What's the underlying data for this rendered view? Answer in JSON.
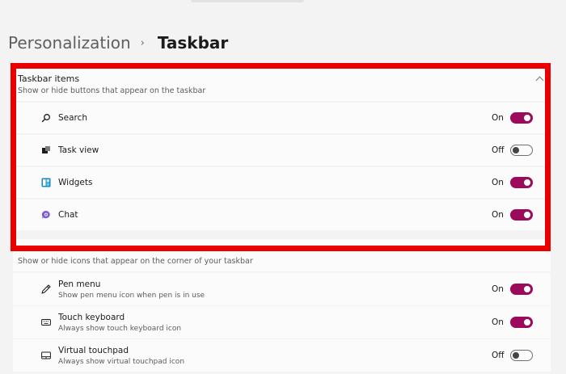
{
  "breadcrumb": {
    "parent": "Personalization",
    "separator": "›",
    "current": "Taskbar"
  },
  "taskbar_items": {
    "title": "Taskbar items",
    "subtitle": "Show or hide buttons that appear on the taskbar",
    "items": [
      {
        "label": "Search",
        "state": "On",
        "icon": "search-icon"
      },
      {
        "label": "Task view",
        "state": "Off",
        "icon": "task-view-icon"
      },
      {
        "label": "Widgets",
        "state": "On",
        "icon": "widgets-icon"
      },
      {
        "label": "Chat",
        "state": "On",
        "icon": "chat-icon"
      }
    ]
  },
  "corner_icons": {
    "subtitle": "Show or hide icons that appear on the corner of your taskbar",
    "items": [
      {
        "label": "Pen menu",
        "desc": "Show pen menu icon when pen is in use",
        "state": "On",
        "icon": "pen-icon"
      },
      {
        "label": "Touch keyboard",
        "desc": "Always show touch keyboard icon",
        "state": "On",
        "icon": "keyboard-icon"
      },
      {
        "label": "Virtual touchpad",
        "desc": "Always show virtual touchpad icon",
        "state": "Off",
        "icon": "touchpad-icon"
      }
    ]
  },
  "colors": {
    "toggle_on": "#9b0a5b",
    "highlight_frame": "#ea0000"
  }
}
